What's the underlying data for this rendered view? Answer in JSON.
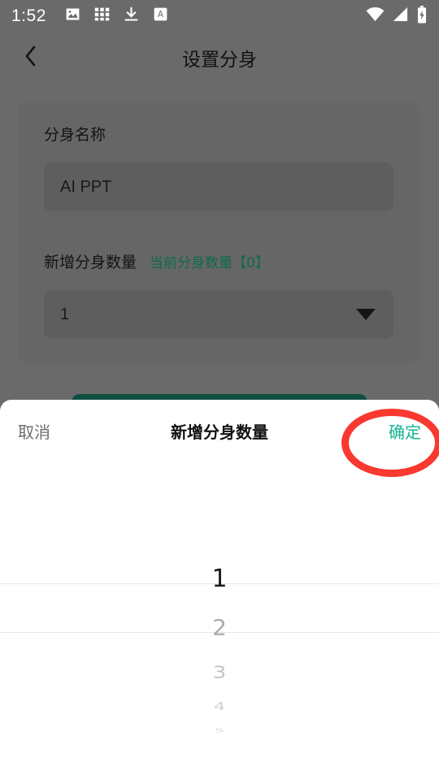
{
  "status_bar": {
    "clock": "1:52",
    "left_icons": [
      "image-icon",
      "apps-grid-icon",
      "download-icon",
      "translate-icon"
    ],
    "right_icons": [
      "wifi-icon",
      "cellular-signal-icon",
      "battery-charging-icon"
    ]
  },
  "app": {
    "title": "设置分身",
    "back_icon": "chevron-left-icon"
  },
  "form": {
    "name_label": "分身名称",
    "name_value": "AI PPT",
    "count_label": "新增分身数量",
    "count_hint": "当前分身数量【0】",
    "count_value": "1",
    "dropdown_icon": "caret-down-icon"
  },
  "sheet": {
    "cancel_label": "取消",
    "title": "新增分身数量",
    "confirm_label": "确定",
    "picker": {
      "selected_index": 0,
      "options": [
        "1",
        "2",
        "3",
        "4",
        "5"
      ]
    }
  },
  "annotation": {
    "shape": "ellipse-highlight",
    "target": "确定"
  },
  "colors": {
    "accent_teal": "#16b392",
    "hint_green": "#0d6b4f",
    "primary_button": "#0d4f41",
    "annotation_red": "#f9382f",
    "scrim": "#6a6a6a",
    "sheet_bg": "#ffffff"
  }
}
